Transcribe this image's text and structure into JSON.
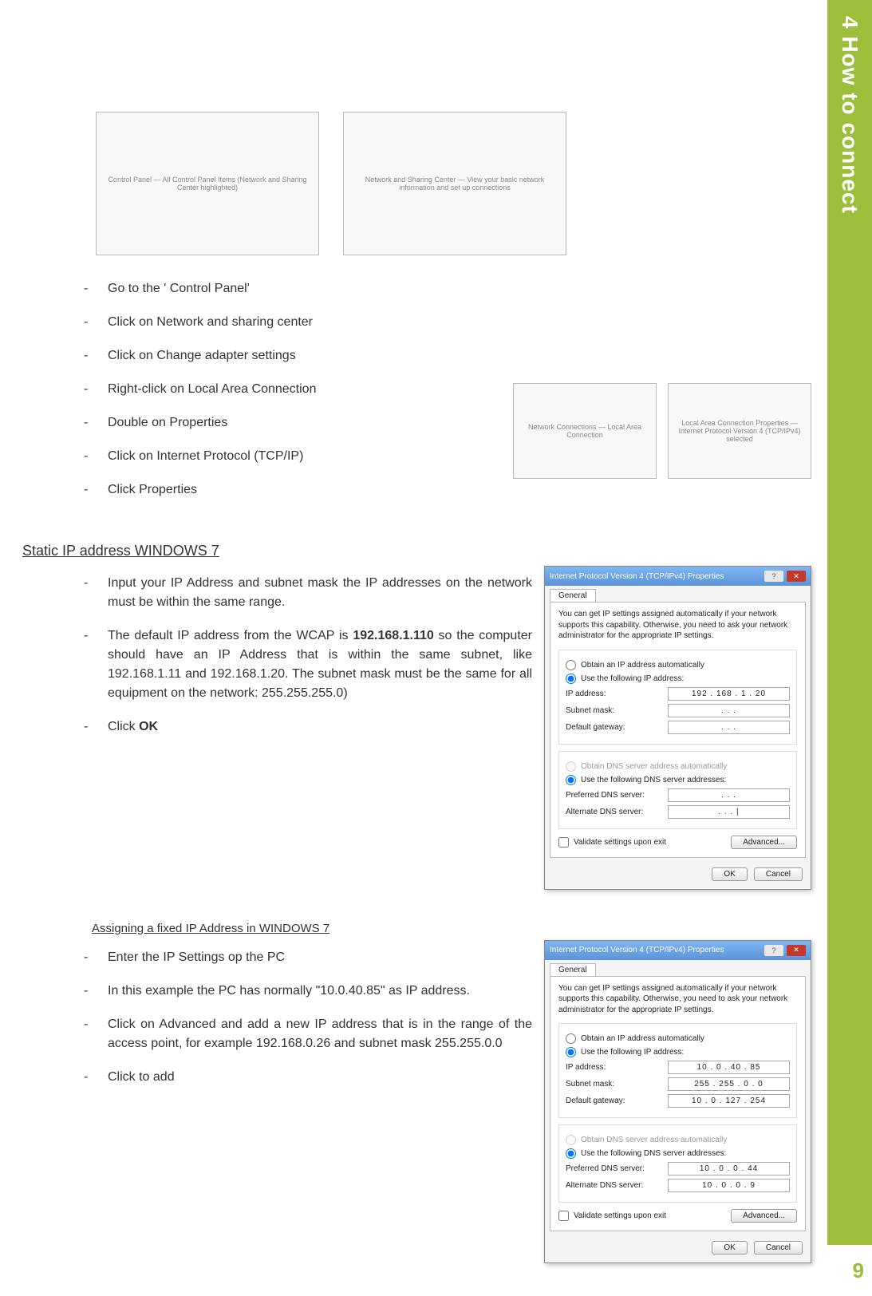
{
  "sidebar": {
    "chapter": "4  How to connect"
  },
  "page_number": "9",
  "screenshots": {
    "cp1": "Control Panel — All Control Panel Items (Network and Sharing Center highlighted)",
    "cp2": "Network and Sharing Center — View your basic network information and set up connections",
    "nc1": "Network Connections — Local Area Connection",
    "nc2": "Local Area Connection Properties — Internet Protocol Version 4 (TCP/IPv4) selected"
  },
  "steps_control_panel": [
    "Go to the ' Control Panel'",
    "Click on Network and sharing center",
    "Click on Change adapter settings",
    "Right-click on Local Area Connection",
    "Double on Properties",
    "Click on Internet Protocol (TCP/IP)",
    "Click Properties"
  ],
  "section_static": {
    "title": "Static IP address WINDOWS 7",
    "items": [
      "Input your IP Address and subnet mask the IP addresses on the network must be within the same range.",
      "The default IP address from the WCAP is 192.168.1.110 so the computer should have an IP Address that is within the same subnet, like 192.168.1.11 and 192.168.1.20. The subnet mask must be the same for all equipment on the network: 255.255.255.0)",
      "Click OK"
    ]
  },
  "section_fixed": {
    "title": "Assigning a fixed IP Address in WINDOWS 7",
    "items": [
      "Enter the IP Settings op the PC",
      "In this example the PC has normally \"10.0.40.85\"  as IP address.",
      "Click on Advanced and add a new IP address that is in the range of the access point, for example 192.168.0.26 and subnet mask 255.255.0.0",
      "Click to add"
    ]
  },
  "dialog_common": {
    "tab_general": "General",
    "hint": "You can get IP settings assigned automatically if your network supports this capability. Otherwise, you need to ask your network administrator for the appropriate IP settings.",
    "radio_auto_ip": "Obtain an IP address automatically",
    "radio_use_ip": "Use the following IP address:",
    "lbl_ip": "IP address:",
    "lbl_subnet": "Subnet mask:",
    "lbl_gateway": "Default gateway:",
    "radio_auto_dns": "Obtain DNS server address automatically",
    "radio_use_dns": "Use the following DNS server addresses:",
    "lbl_pref_dns": "Preferred DNS server:",
    "lbl_alt_dns": "Alternate DNS server:",
    "chk_validate": "Validate settings upon exit",
    "btn_advanced": "Advanced...",
    "btn_ok": "OK",
    "btn_cancel": "Cancel"
  },
  "dialog1": {
    "title": "Internet Protocol Version 4 (TCP/IPv4) Properties",
    "ip": "192 . 168 .  1  .  20",
    "subnet": ".       .       .",
    "gateway": ".       .       .",
    "pref_dns": ".       .       .",
    "alt_dns": ".       .       .   |"
  },
  "dialog2": {
    "title": "Internet Protocol Version 4 (TCP/IPv4) Properties",
    "ip": "10  .  0  .  40  .  85",
    "subnet": "255 . 255 .  0  .  0",
    "gateway": "10  .  0  . 127 . 254",
    "pref_dns": "10  .  0  .  0  .  44",
    "alt_dns": "10  .  0  .  0  .   9"
  }
}
